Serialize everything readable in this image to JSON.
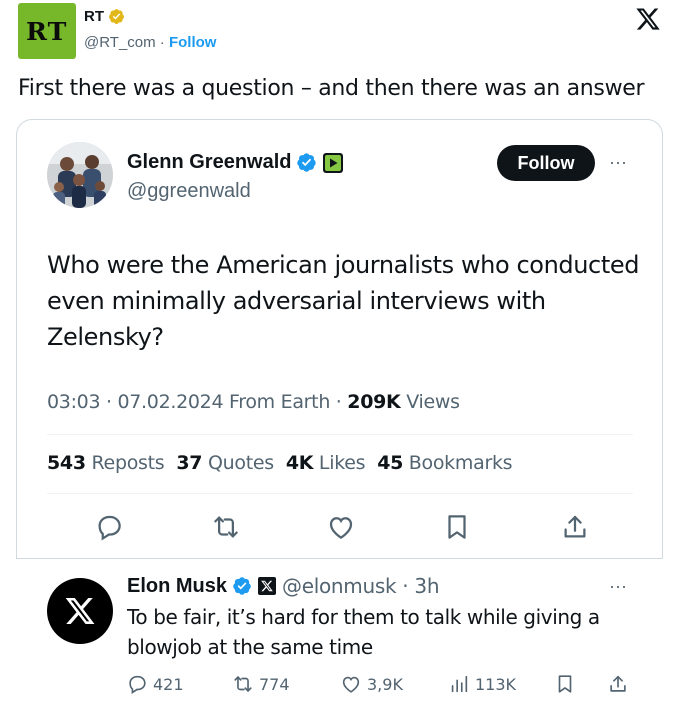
{
  "embed": {
    "account_name": "RT",
    "logo_text": "RT",
    "handle": "@RT_com",
    "separator": " · ",
    "follow_link": "Follow",
    "text": "First there was a question – and then there was an answer"
  },
  "quoted_tweet": {
    "author_name": "Glenn Greenwald",
    "author_handle": "@ggreenwald",
    "follow_button": "Follow",
    "more": "···",
    "body": "Who were the American journalists who conducted even minimally adversarial interviews with Zelensky?",
    "meta": {
      "time_date": "03:03 · 07.02.2024 From Earth · ",
      "views_count": "209K",
      "views_label": " Views"
    },
    "stats": [
      {
        "count": "543",
        "label": " Reposts"
      },
      {
        "count": "37",
        "label": " Quotes"
      },
      {
        "count": "4K",
        "label": " Likes"
      },
      {
        "count": "45",
        "label": " Bookmarks"
      }
    ]
  },
  "reply": {
    "author_name": "Elon Musk",
    "author_handle": "@elonmusk",
    "time": " · 3h",
    "more": "···",
    "body": "To be fair, it’s hard for them to talk while giving a blowjob at the same time",
    "actions": {
      "replies": "421",
      "reposts": "774",
      "likes": "3,9K",
      "views": "113K"
    }
  },
  "colors": {
    "verified_blue": "#1d9bf0",
    "verified_gold": "#e2b719",
    "rt_green": "#77b82a",
    "muted": "#536471",
    "text": "#0f1419",
    "rumble_green": "#85c742"
  }
}
